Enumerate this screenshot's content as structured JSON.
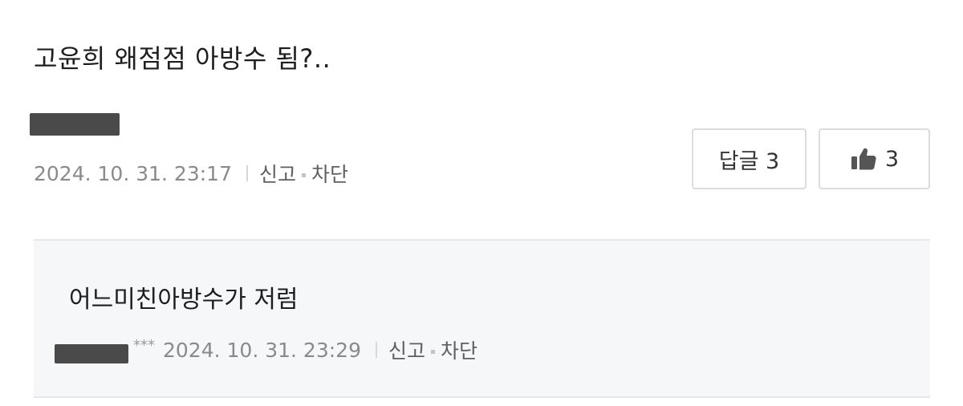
{
  "comment": {
    "text": "고윤희 왜점점 아방수 됨?..",
    "timestamp": "2024. 10. 31. 23:17",
    "report_label": "신고",
    "block_label": "차단",
    "reply_button_label": "답글 3",
    "like_count": "3",
    "like_icon": "thumbs-up-icon"
  },
  "reply": {
    "text": "어느미친아방수가 저럼",
    "author_masked_suffix": "***",
    "timestamp": "2024. 10. 31. 23:29",
    "report_label": "신고",
    "block_label": "차단"
  },
  "colors": {
    "reply_background": "#f6f7f9",
    "button_border": "#dcdcdc",
    "meta_text": "#8a8a8a",
    "redaction": "#4a4a4a"
  }
}
